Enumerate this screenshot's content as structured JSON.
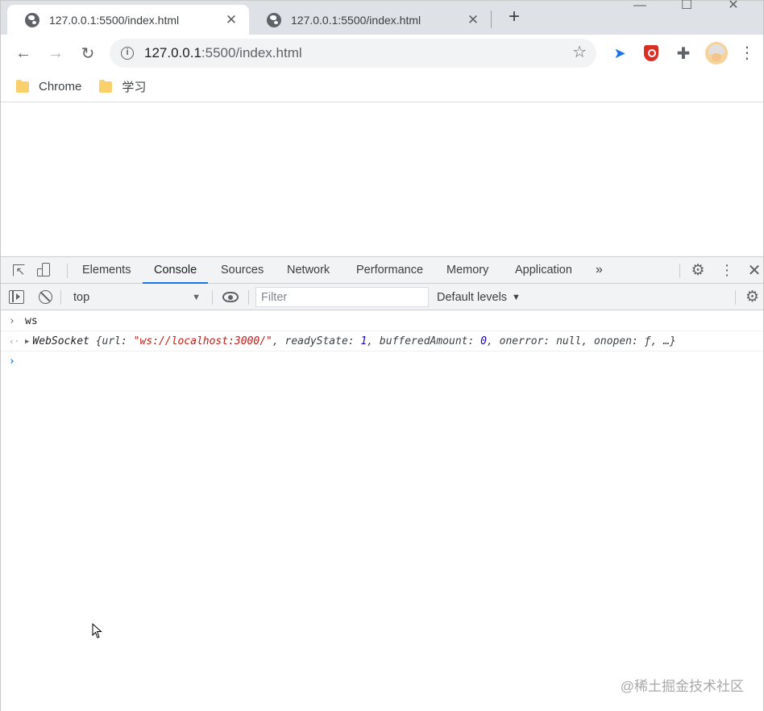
{
  "browser": {
    "tabs": [
      {
        "title": "127.0.0.1:5500/index.html",
        "active": true
      },
      {
        "title": "127.0.0.1:5500/index.html",
        "active": false
      }
    ],
    "new_tab_symbol": "+",
    "address": {
      "host": "127.0.0.1",
      "rest": ":5500/index.html"
    },
    "bookmarks": [
      {
        "label": "Chrome",
        "icon": "folder-icon"
      },
      {
        "label": "学习",
        "icon": "folder-icon"
      }
    ]
  },
  "devtools": {
    "tabs": [
      "Elements",
      "Console",
      "Sources",
      "Network",
      "Performance",
      "Memory",
      "Application"
    ],
    "selected_tab": "Console",
    "more_tabs_symbol": "»",
    "console_toolbar": {
      "context": "top",
      "filter_placeholder": "Filter",
      "levels": "Default levels"
    },
    "console_lines": {
      "input": "ws",
      "result": {
        "type_name": "WebSocket",
        "open": " {url: ",
        "url_value": "\"ws://localhost:3000/\"",
        "ready_key": ", readyState: ",
        "ready_value": "1",
        "buffered_key": ", bufferedAmount: ",
        "buffered_value": "0",
        "tail": ", onerror: null, onopen: ƒ, …}"
      }
    }
  },
  "watermark": "@稀土掘金技术社区",
  "colors": {
    "accent": "#1a73e8",
    "string": "#c41a16",
    "number": "#1c00cf",
    "tabstrip": "#dee1e6"
  }
}
